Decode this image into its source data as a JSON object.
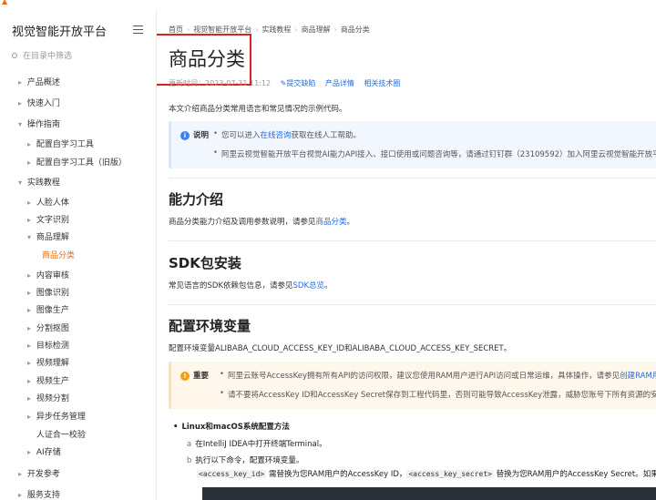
{
  "sidebar": {
    "title": "视觉智能开放平台",
    "search_placeholder": "在目录中筛选",
    "items": [
      {
        "label": "产品概述",
        "arrow": "▸"
      },
      {
        "label": "快速入门",
        "arrow": "▸"
      },
      {
        "label": "操作指南",
        "arrow": "▾"
      },
      {
        "label": "配置自学习工具",
        "arrow": "▸"
      },
      {
        "label": "配置自学习工具（旧版）",
        "arrow": "▸"
      },
      {
        "label": "实践教程",
        "arrow": "▾"
      },
      {
        "label": "人脸人体",
        "arrow": "▸"
      },
      {
        "label": "文字识别",
        "arrow": "▸"
      },
      {
        "label": "商品理解",
        "arrow": "▾"
      },
      {
        "label": "商品分类",
        "arrow": ""
      },
      {
        "label": "内容审核",
        "arrow": "▸"
      },
      {
        "label": "图像识别",
        "arrow": "▸"
      },
      {
        "label": "图像生产",
        "arrow": "▸"
      },
      {
        "label": "分割抠图",
        "arrow": "▸"
      },
      {
        "label": "目标检测",
        "arrow": "▸"
      },
      {
        "label": "视频理解",
        "arrow": "▸"
      },
      {
        "label": "视频生产",
        "arrow": "▸"
      },
      {
        "label": "视频分割",
        "arrow": "▸"
      },
      {
        "label": "异步任务管理",
        "arrow": "▸"
      },
      {
        "label": "人证合一校验",
        "arrow": ""
      },
      {
        "label": "AI存储",
        "arrow": "▸"
      },
      {
        "label": "开发参考",
        "arrow": "▸"
      },
      {
        "label": "服务支持",
        "arrow": "▸"
      }
    ]
  },
  "breadcrumb": [
    "首页",
    "视觉智能开放平台",
    "实践教程",
    "商品理解",
    "商品分类"
  ],
  "page": {
    "title": "商品分类",
    "updated": "更新时间：2023-07-31 11:12",
    "meta_links": [
      "提交缺陷",
      "产品详情",
      "相关技术圈"
    ],
    "intro": "本文介绍商品分类常用语言和常见情况的示例代码。",
    "note": {
      "label": "说明",
      "icon": "i",
      "line1_pre": "您可以进入",
      "line1_link": "在线咨询",
      "line1_post": "获取在线人工帮助。",
      "line2": "阿里云视觉智能开放平台视觉AI能力API接入、接口使用或问题咨询等，请通过钉钉群（23109592）加入阿里云视觉智能开放平台"
    },
    "sec1": {
      "heading": "能力介绍",
      "text_pre": "商品分类能力介绍及调用参数说明，请参见",
      "link": "商品分类",
      "text_post": "。"
    },
    "sec2": {
      "heading": "SDK包安装",
      "text_pre": "常见语言的SDK依赖包信息，请参见",
      "link": "SDK总览",
      "text_post": "。"
    },
    "sec3": {
      "heading": "配置环境变量",
      "text": "配置环境变量ALIBABA_CLOUD_ACCESS_KEY_ID和ALIBABA_CLOUD_ACCESS_KEY_SECRET。"
    },
    "warn": {
      "label": "重要",
      "icon": "!",
      "line1_pre": "阿里云账号AccessKey拥有所有API的访问权限，建议您使用RAM用户进行API访问或日常运维，具体操作，请参见",
      "line1_link": "创建RAM用户",
      "line1_post": "。",
      "line2": "请不要将AccessKey ID和AccessKey Secret保存到工程代码里，否则可能导致AccessKey泄露，威胁您账号下所有资源的安全。"
    },
    "linux": {
      "title": "Linux和macOS系统配置方法",
      "step_a_letter": "a",
      "step_a": "在IntelliJ IDEA中打开终端Terminal。",
      "step_b_letter": "b",
      "step_b": "执行以下命令，配置环境变量。",
      "code1": "<access_key_id>",
      "mid1": " 需替换为您RAM用户的AccessKey ID，",
      "code2": "<access_key_secret>",
      "mid2": " 替换为您RAM用户的AccessKey Secret。如果后续需要"
    }
  }
}
